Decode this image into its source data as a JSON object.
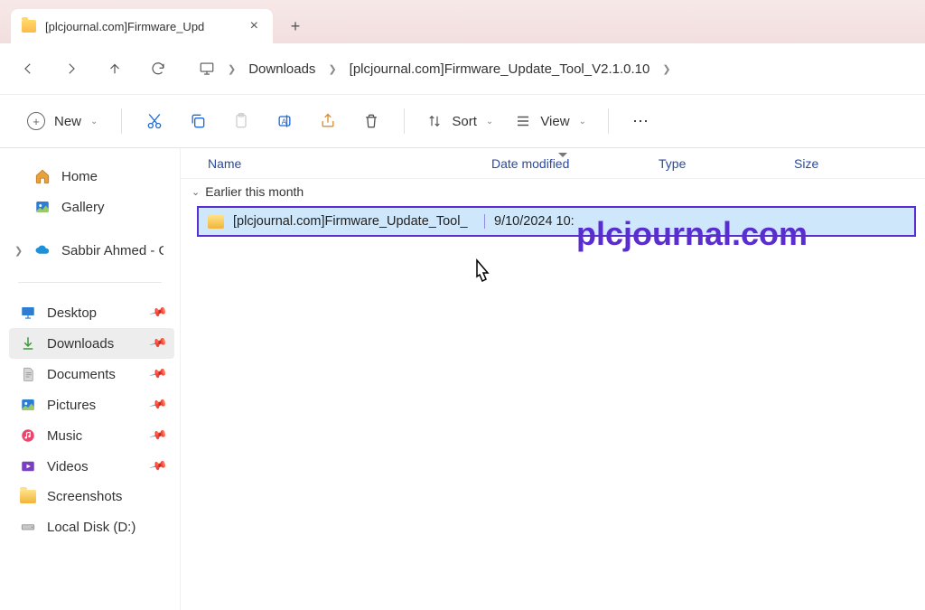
{
  "tab": {
    "title": "[plcjournal.com]Firmware_Upd",
    "close": "×",
    "new": "+"
  },
  "breadcrumbs": {
    "b1": "Downloads",
    "b2": "[plcjournal.com]Firmware_Update_Tool_V2.1.0.10"
  },
  "toolbar": {
    "new": "New",
    "sort": "Sort",
    "view": "View",
    "more": "⋯"
  },
  "sidebar": {
    "home": "Home",
    "gallery": "Gallery",
    "onedrive": "Sabbir Ahmed - Glo",
    "desktop": "Desktop",
    "downloads": "Downloads",
    "documents": "Documents",
    "pictures": "Pictures",
    "music": "Music",
    "videos": "Videos",
    "screenshots": "Screenshots",
    "localdisk": "Local Disk (D:)"
  },
  "columns": {
    "name": "Name",
    "date": "Date modified",
    "type": "Type",
    "size": "Size"
  },
  "group": {
    "label": "Earlier this month"
  },
  "row": {
    "name": "[plcjournal.com]Firmware_Update_Tool_",
    "date": "9/10/2024 10:"
  },
  "watermark": "plcjournal.com"
}
